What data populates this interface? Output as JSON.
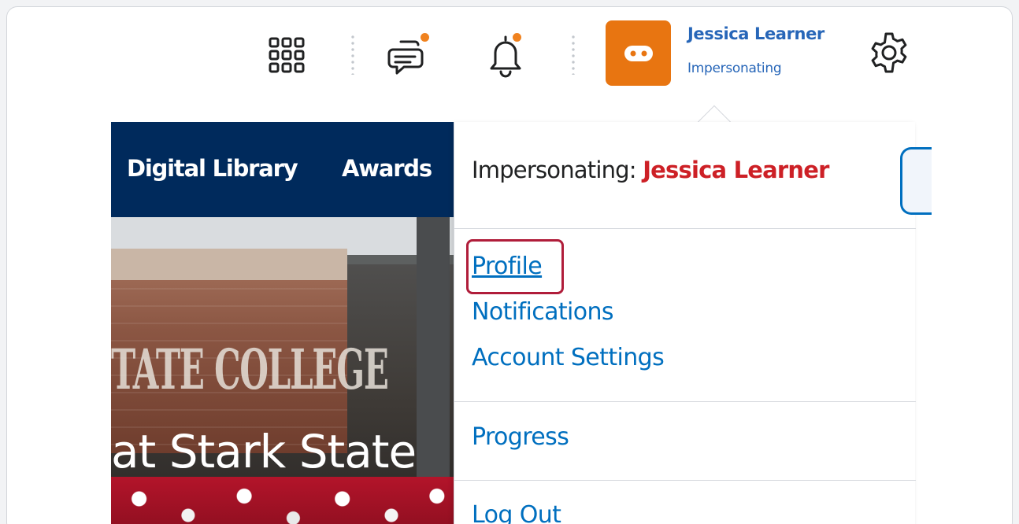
{
  "minibar": {
    "waffle_icon": "waffle-grid-icon",
    "messages_icon": "message-alert-icon",
    "notifications_icon": "bell-icon",
    "badge_color": "#f0821f",
    "user": {
      "name": "Jessica Learner",
      "status": "Impersonating",
      "avatar_color": "#e87511",
      "avatar_icon": "impersonation-mask-icon"
    },
    "settings_icon": "gear-icon"
  },
  "navbar": {
    "items": [
      {
        "label": "Digital Library"
      },
      {
        "label": "Awards"
      }
    ],
    "background": "#002a5c"
  },
  "hero": {
    "title": "at Stark State",
    "sign_text": "TATE COLLEGE"
  },
  "dropdown": {
    "impersonating_label": "Impersonating:",
    "impersonating_name": "Jessica Learner",
    "menu_items": [
      {
        "label": "Profile",
        "highlighted": true
      },
      {
        "label": "Notifications"
      },
      {
        "label": "Account Settings"
      },
      {
        "label": "Progress"
      },
      {
        "label": "Log Out"
      }
    ],
    "link_color": "#006fbf",
    "name_color": "#cd2026",
    "highlight_color": "#b01d3a"
  }
}
